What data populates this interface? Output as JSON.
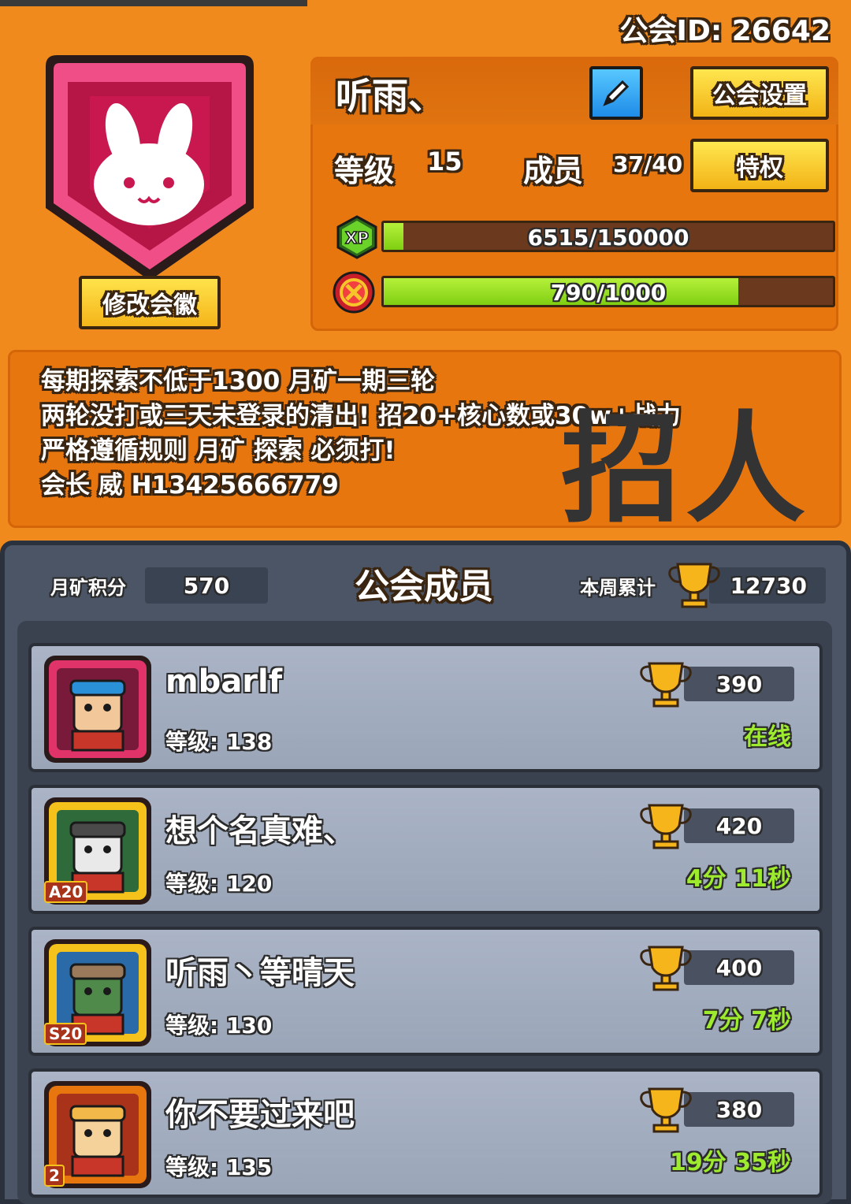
{
  "guild": {
    "id_text": "公会ID: 26642",
    "name": "听雨、",
    "edit_badge_label": "修改会徽",
    "settings_label": "公会设置",
    "privilege_label": "特权",
    "level_label": "等级",
    "level_value": "15",
    "members_label": "成员",
    "members_value": "37/40",
    "xp_icon_text": "XP",
    "xp_text": "6515/150000",
    "xp_fraction": 0.0434,
    "activity_text": "790/1000",
    "activity_fraction": 0.79
  },
  "notice": {
    "lines": [
      "每期探索不低于1300 月矿一期三轮",
      "两轮没打或三天未登录的清出! 招20+核心数或30w+战力",
      "严格遵循规则 月矿 探索 必须打!",
      " 会长 威 H13425666779"
    ],
    "overlay": "招人"
  },
  "members_panel": {
    "title": "公会成员",
    "mine_score_label": "月矿积分",
    "mine_score_value": "570",
    "weekly_label": "本周累计",
    "weekly_value": "12730",
    "level_prefix": "等级:",
    "list": [
      {
        "name": "mbarlf",
        "level": "138",
        "trophies": "390",
        "status": "在线",
        "badge": ""
      },
      {
        "name": "想个名真难、",
        "level": "120",
        "trophies": "420",
        "status": "4分 11秒",
        "badge": "A20"
      },
      {
        "name": "听雨丶等晴天",
        "level": "130",
        "trophies": "400",
        "status": "7分 7秒",
        "badge": "S20"
      },
      {
        "name": "你不要过来吧",
        "level": "135",
        "trophies": "380",
        "status": "19分 35秒",
        "badge": "2"
      }
    ]
  },
  "colors": {
    "background": "#f08a1c",
    "badge_pink": "#e0336a",
    "button_yellow": "#f4c21a",
    "bar_green": "#9be326",
    "panel_slate": "#4b5566",
    "status_green": "#9dea2f"
  },
  "icons": [
    "pencil-icon",
    "xp-icon",
    "crossed-swords-icon",
    "trophy-icon",
    "rabbit-emblem-icon"
  ]
}
